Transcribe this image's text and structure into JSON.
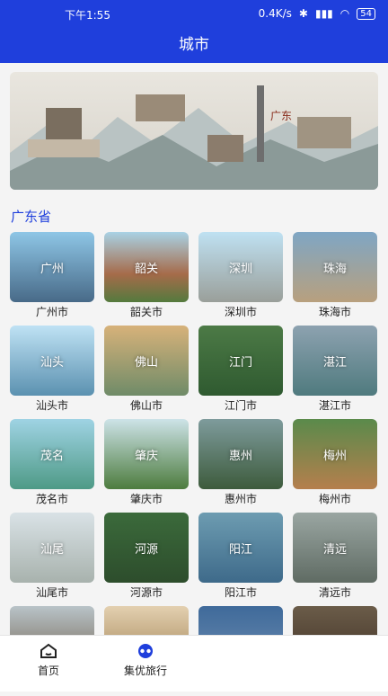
{
  "status_bar": {
    "time": "下午1:55",
    "network": "0.4K/s",
    "battery": "54"
  },
  "header": {
    "title": "城市"
  },
  "banner": {
    "caption": "广东"
  },
  "section": {
    "title": "广东省"
  },
  "cities": [
    {
      "label": "广州",
      "name": "广州市"
    },
    {
      "label": "韶关",
      "name": "韶关市"
    },
    {
      "label": "深圳",
      "name": "深圳市"
    },
    {
      "label": "珠海",
      "name": "珠海市"
    },
    {
      "label": "汕头",
      "name": "汕头市"
    },
    {
      "label": "佛山",
      "name": "佛山市"
    },
    {
      "label": "江门",
      "name": "江门市"
    },
    {
      "label": "湛江",
      "name": "湛江市"
    },
    {
      "label": "茂名",
      "name": "茂名市"
    },
    {
      "label": "肇庆",
      "name": "肇庆市"
    },
    {
      "label": "惠州",
      "name": "惠州市"
    },
    {
      "label": "梅州",
      "name": "梅州市"
    },
    {
      "label": "汕尾",
      "name": "汕尾市"
    },
    {
      "label": "河源",
      "name": "河源市"
    },
    {
      "label": "阳江",
      "name": "阳江市"
    },
    {
      "label": "清远",
      "name": "清远市"
    }
  ],
  "tabbar": {
    "home": "首页",
    "travel": "集优旅行"
  }
}
